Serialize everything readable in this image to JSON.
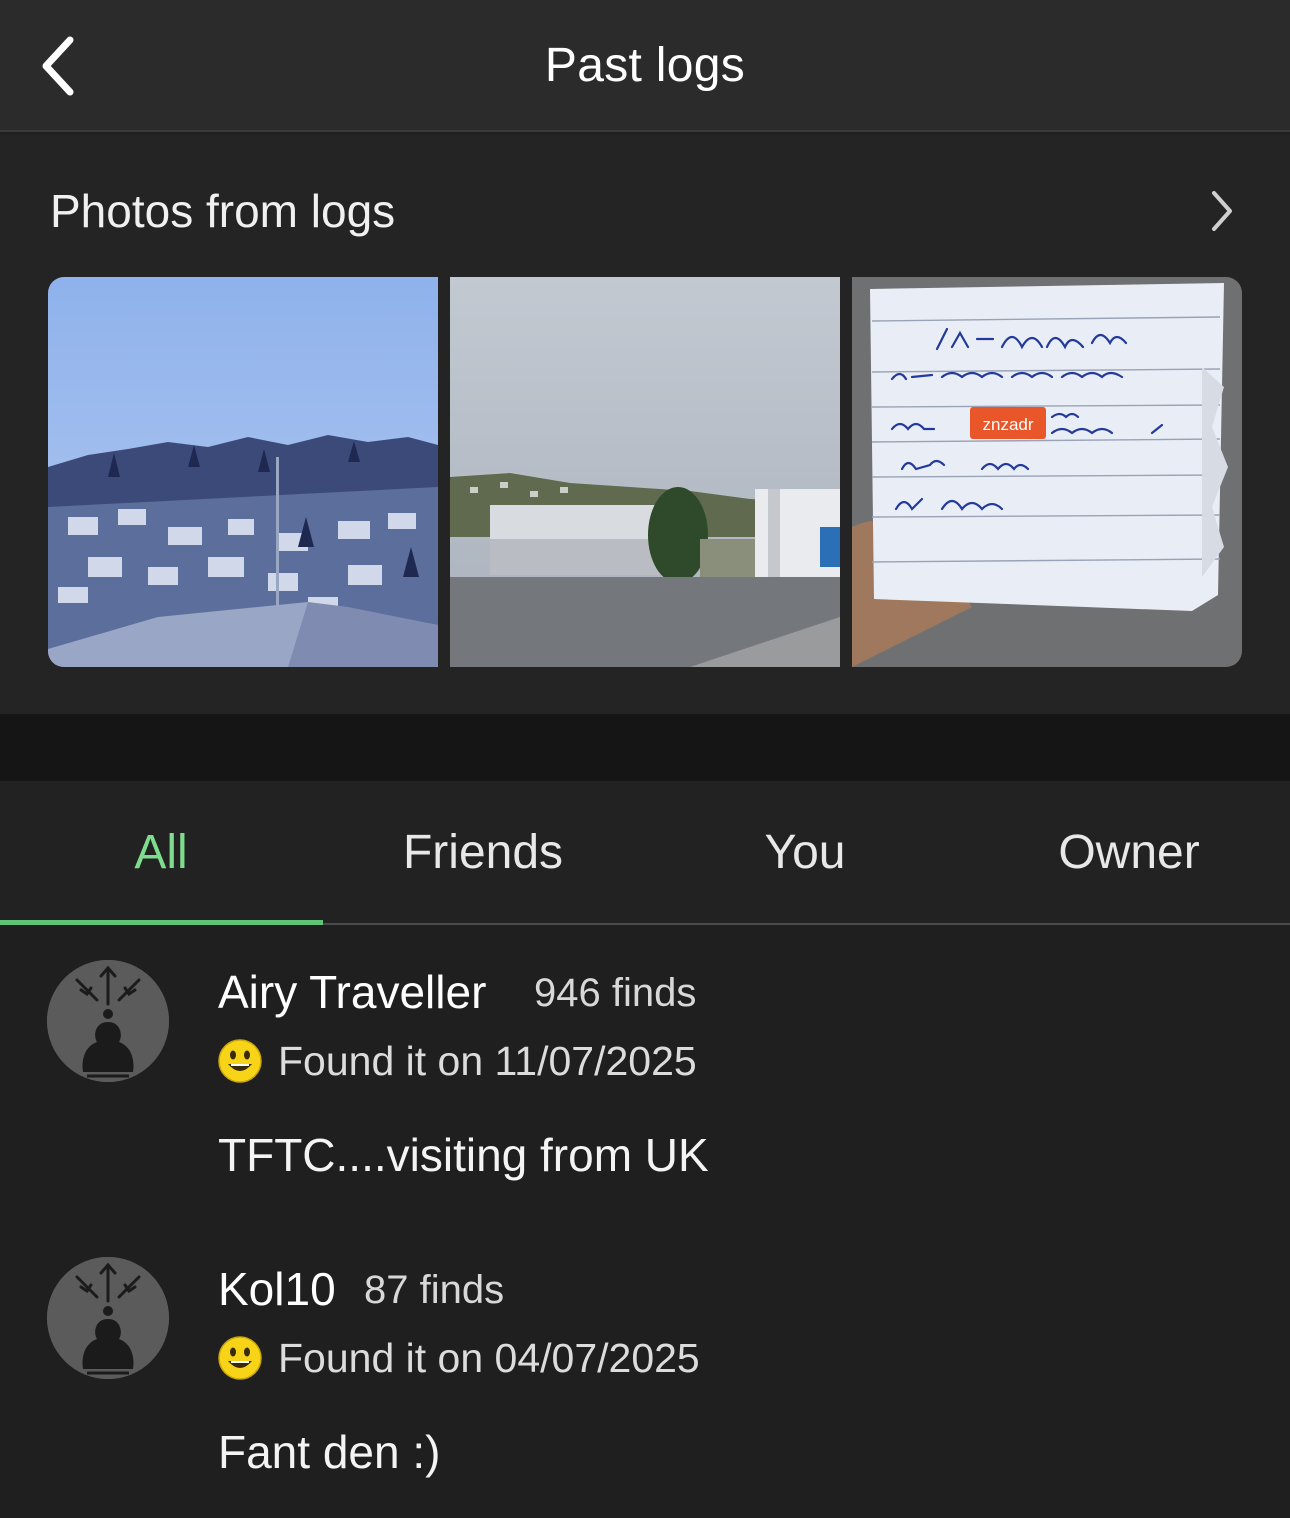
{
  "header": {
    "title": "Past logs",
    "back_icon": "chevron-left-icon"
  },
  "photos": {
    "title": "Photos from logs",
    "chevron_icon": "chevron-right-icon",
    "thumbnails": [
      {
        "description_icon": "photo-thumbnail"
      },
      {
        "description_icon": "photo-thumbnail"
      },
      {
        "description_icon": "photo-thumbnail",
        "overlay_label": "znzadr"
      }
    ]
  },
  "tabs": {
    "items": [
      {
        "label": "All",
        "active": true
      },
      {
        "label": "Friends",
        "active": false
      },
      {
        "label": "You",
        "active": false
      },
      {
        "label": "Owner",
        "active": false
      }
    ]
  },
  "logs": [
    {
      "name": "Airy Traveller",
      "finds": "946 finds",
      "status": "Found it on 11/07/2025",
      "text": "TFTC....visiting from UK"
    },
    {
      "name": "Kol10",
      "finds": "87 finds",
      "status": "Found it on 04/07/2025",
      "text": "Fant den :)"
    }
  ],
  "colors": {
    "accent": "#7ddc8e",
    "indicator": "#5fc476",
    "background": "#1f1f1f",
    "header": "#2b2b2b",
    "znzadr_tag": "#e8562a"
  }
}
